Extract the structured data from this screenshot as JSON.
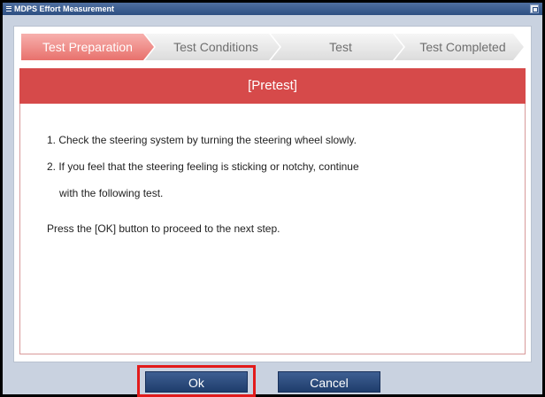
{
  "window": {
    "title": "MDPS Effort Measurement"
  },
  "steps": [
    {
      "label": "Test Preparation",
      "active": true
    },
    {
      "label": "Test Conditions",
      "active": false
    },
    {
      "label": "Test",
      "active": false
    },
    {
      "label": "Test Completed",
      "active": false
    }
  ],
  "section": {
    "title": "[Pretest]"
  },
  "instructions": {
    "line1": "1. Check the steering system by turning the steering wheel slowly.",
    "line2": "2. If you feel that the steering feeling is sticking or notchy, continue",
    "line3": "with the following test.",
    "line4": "Press the [OK] button to proceed to the next step."
  },
  "buttons": {
    "ok": "Ok",
    "cancel": "Cancel"
  },
  "colors": {
    "accent": "#d64a4a",
    "button": "#2d4f82",
    "highlight": "#e21b1b"
  }
}
